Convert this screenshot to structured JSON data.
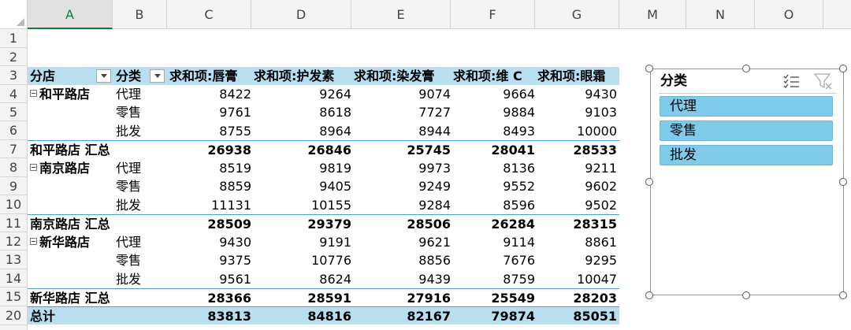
{
  "columns": [
    "A",
    "B",
    "C",
    "D",
    "E",
    "F",
    "G",
    "M",
    "N",
    "O"
  ],
  "rows": [
    "1",
    "2",
    "3",
    "4",
    "5",
    "6",
    "7",
    "8",
    "9",
    "10",
    "11",
    "12",
    "13",
    "14",
    "15",
    "20"
  ],
  "pivot": {
    "headers": {
      "store": "分店",
      "category": "分类",
      "c": "求和项:唇膏",
      "d": "求和项:护发素",
      "e": "求和项:染发膏",
      "f": "求和项:维 C",
      "g": "求和项:眼霜"
    },
    "lines": [
      {
        "store": "和平路店",
        "cat": "代理",
        "v": [
          "8422",
          "9264",
          "9074",
          "9664",
          "9430"
        ]
      },
      {
        "store": "",
        "cat": "零售",
        "v": [
          "9761",
          "8618",
          "7727",
          "9884",
          "9103"
        ]
      },
      {
        "store": "",
        "cat": "批发",
        "v": [
          "8755",
          "8964",
          "8944",
          "8493",
          "10000"
        ]
      },
      {
        "subtotal": "和平路店 汇总",
        "v": [
          "26938",
          "26846",
          "25745",
          "28041",
          "28533"
        ]
      },
      {
        "store": "南京路店",
        "cat": "代理",
        "v": [
          "8519",
          "9819",
          "9973",
          "8136",
          "9211"
        ]
      },
      {
        "store": "",
        "cat": "零售",
        "v": [
          "8859",
          "9405",
          "9249",
          "9552",
          "9602"
        ]
      },
      {
        "store": "",
        "cat": "批发",
        "v": [
          "11131",
          "10155",
          "9284",
          "8596",
          "9502"
        ]
      },
      {
        "subtotal": "南京路店 汇总",
        "v": [
          "28509",
          "29379",
          "28506",
          "26284",
          "28315"
        ]
      },
      {
        "store": "新华路店",
        "cat": "代理",
        "v": [
          "9430",
          "9191",
          "9621",
          "9114",
          "8861"
        ]
      },
      {
        "store": "",
        "cat": "零售",
        "v": [
          "9375",
          "10776",
          "8856",
          "7676",
          "9295"
        ]
      },
      {
        "store": "",
        "cat": "批发",
        "v": [
          "9561",
          "8624",
          "9439",
          "8759",
          "10047"
        ]
      },
      {
        "subtotal": "新华路店 汇总",
        "v": [
          "28366",
          "28591",
          "27916",
          "25549",
          "28203"
        ]
      }
    ],
    "grand_total": {
      "label": "总计",
      "v": [
        "83813",
        "84816",
        "82167",
        "79874",
        "85051"
      ]
    }
  },
  "slicer": {
    "title": "分类",
    "items": [
      "代理",
      "零售",
      "批发"
    ]
  },
  "colors": {
    "header_fill": "#b7dff0",
    "slicer_item": "#7fcbea",
    "active_col": "#107c41"
  }
}
